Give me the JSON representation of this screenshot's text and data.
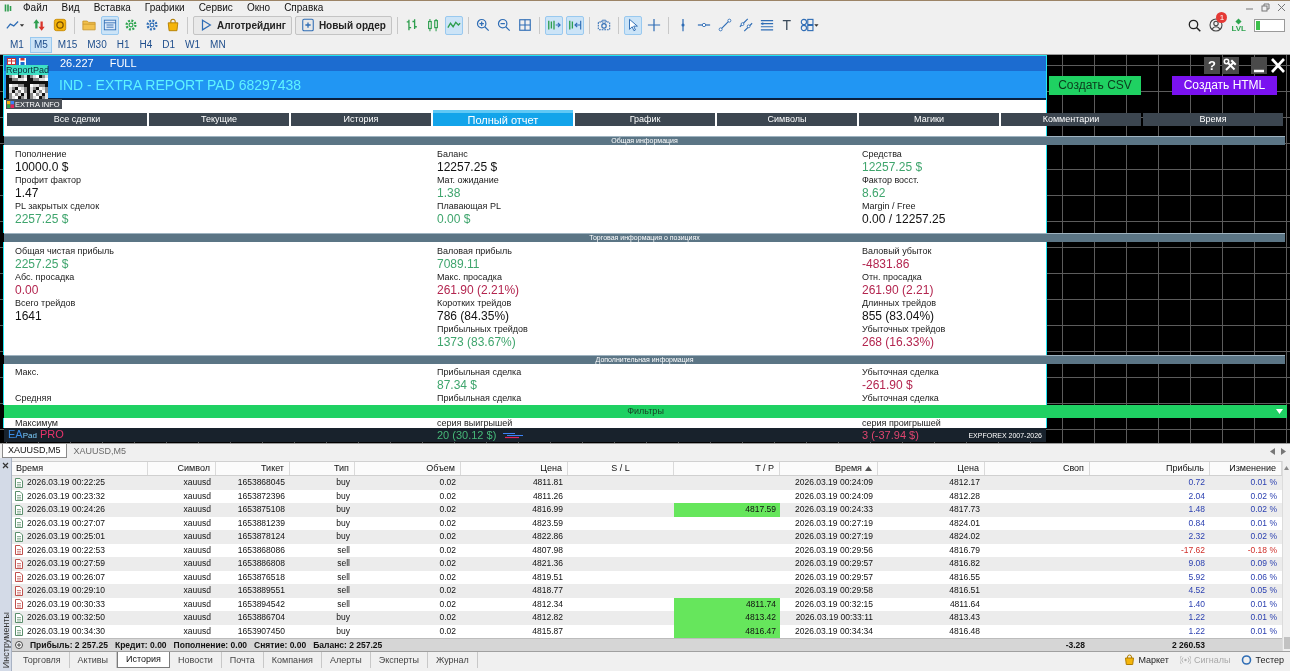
{
  "menu": [
    "Файл",
    "Вид",
    "Вставка",
    "Графики",
    "Сервис",
    "Окно",
    "Справка"
  ],
  "toolbar": {
    "items": [
      {
        "kind": "tool",
        "selected": false
      },
      {
        "kind": "tool",
        "selected": false
      },
      {
        "kind": "tool",
        "selected": false
      },
      {
        "kind": "separator"
      },
      {
        "kind": "tool",
        "selected": false
      },
      {
        "kind": "tool",
        "selected": true
      },
      {
        "kind": "tool",
        "selected": false
      },
      {
        "kind": "tool",
        "selected": false
      },
      {
        "kind": "tool",
        "selected": false
      },
      {
        "kind": "separator"
      },
      {
        "kind": "button",
        "label": "Алготрейдинг"
      },
      {
        "kind": "button",
        "label": "Новый ордер"
      },
      {
        "kind": "separator"
      },
      {
        "kind": "tool",
        "selected": false
      },
      {
        "kind": "tool",
        "selected": false
      },
      {
        "kind": "tool",
        "selected": true
      },
      {
        "kind": "separator"
      },
      {
        "kind": "tool",
        "selected": false
      },
      {
        "kind": "tool",
        "selected": false
      },
      {
        "kind": "tool",
        "selected": false
      },
      {
        "kind": "separator"
      },
      {
        "kind": "tool",
        "selected": true
      },
      {
        "kind": "tool",
        "selected": true
      },
      {
        "kind": "separator"
      },
      {
        "kind": "tool",
        "selected": false
      },
      {
        "kind": "separator"
      },
      {
        "kind": "tool",
        "selected": true
      },
      {
        "kind": "tool",
        "selected": false
      },
      {
        "kind": "separator"
      },
      {
        "kind": "tool",
        "selected": false
      },
      {
        "kind": "tool",
        "selected": false
      },
      {
        "kind": "tool",
        "selected": false
      },
      {
        "kind": "tool",
        "selected": false
      },
      {
        "kind": "tool",
        "selected": false
      },
      {
        "kind": "glyph",
        "label": "T",
        "selected": false
      },
      {
        "kind": "tool",
        "selected": false
      }
    ],
    "notifications": "1",
    "lvl_label": "LVL",
    "meter": {
      "level": 0.15
    }
  },
  "timeframes": [
    {
      "label": "M1",
      "selected": false
    },
    {
      "label": "M5",
      "selected": true
    },
    {
      "label": "M15",
      "selected": false
    },
    {
      "label": "M30",
      "selected": false
    },
    {
      "label": "H1",
      "selected": false
    },
    {
      "label": "H4",
      "selected": false
    },
    {
      "label": "D1",
      "selected": false
    },
    {
      "label": "W1",
      "selected": false
    },
    {
      "label": "MN",
      "selected": false
    }
  ],
  "report": {
    "version": "26.227",
    "mode": "FULL",
    "title": "IND - EXTRA REPORT PAD 68297438",
    "logo": {
      "label": "ReportPad",
      "caption": "EXTRA INFO"
    },
    "help_label": "?",
    "actions": [
      {
        "label": "Создать CSV",
        "color": "#1fd162"
      },
      {
        "label": "Создать HTML",
        "color": "#7a12f0"
      }
    ],
    "tabs": [
      {
        "label": "Все сделки",
        "selected": false
      },
      {
        "label": "Текущие",
        "selected": false
      },
      {
        "label": "История",
        "selected": false
      },
      {
        "label": "Полный отчет",
        "selected": true
      },
      {
        "label": "График",
        "selected": false
      },
      {
        "label": "Символы",
        "selected": false
      },
      {
        "label": "Магики",
        "selected": false
      },
      {
        "label": "Комментарии",
        "selected": false
      },
      {
        "label": "Время",
        "selected": false
      }
    ],
    "sections": [
      {
        "title": "Общая информация",
        "columns": [
          [
            {
              "label": "Пополнение",
              "value": "10000.0 $",
              "color": "#111111"
            },
            {
              "label": "Профит фактор",
              "value": "1.47",
              "color": "#111111"
            },
            {
              "label": "PL закрытых сделок",
              "value": "2257.25 $",
              "color": "#3fa56d"
            }
          ],
          [
            {
              "label": "Баланс",
              "value": "12257.25 $",
              "color": "#111111"
            },
            {
              "label": "Мат. ожидание",
              "value": "1.38",
              "color": "#3fa56d"
            },
            {
              "label": "Плавающая PL",
              "value": "0.00 $",
              "color": "#3fa56d"
            }
          ],
          [
            {
              "label": "Средства",
              "value": "12257.25 $",
              "color": "#3fa56d"
            },
            {
              "label": "Фактор восст.",
              "value": "8.62",
              "color": "#3fa56d"
            },
            {
              "label": "Margin / Free",
              "value": "0.00 / 12257.25",
              "color": "#111111"
            }
          ]
        ]
      },
      {
        "title": "Торговая информация о позициях",
        "columns": [
          [
            {
              "label": "Общая чистая прибыль",
              "value": "2257.25 $",
              "color": "#3fa56d"
            },
            {
              "label": "Абс. просадка",
              "value": "0.00",
              "color": "#b3254f"
            },
            {
              "label": "Всего трейдов",
              "value": "1641",
              "color": "#111111"
            }
          ],
          [
            {
              "label": "Валовая прибыль",
              "value": "7089.11",
              "color": "#3fa56d"
            },
            {
              "label": "Макс. просадка",
              "value": "261.90 (2.21%)",
              "color": "#b3254f"
            },
            {
              "label": "Коротких трейдов",
              "value": "786 (84.35%)",
              "color": "#111111"
            },
            {
              "label": "Прибыльных трейдов",
              "value": "1373 (83.67%)",
              "color": "#3fa56d"
            }
          ],
          [
            {
              "label": "Валовый убыток",
              "value": "-4831.86",
              "color": "#b3254f"
            },
            {
              "label": "Отн. просадка",
              "value": "261.90 (2.21)",
              "color": "#b3254f"
            },
            {
              "label": "Длинных трейдов",
              "value": "855 (83.04%)",
              "color": "#111111"
            },
            {
              "label": "Убыточных трейдов",
              "value": "268 (16.33%)",
              "color": "#b3254f"
            }
          ]
        ]
      },
      {
        "title": "Дополнительная информация",
        "columns": [
          [
            {
              "label": "Макс."
            },
            {
              "label": "Средняя"
            }
          ],
          [
            {
              "label": "Прибыльная сделка",
              "value": "87.34 $",
              "color": "#3fa56d"
            },
            {
              "label": "Прибыльная сделка"
            }
          ],
          [
            {
              "label": "Убыточная сделка",
              "value": "-261.90 $",
              "color": "#b3254f"
            },
            {
              "label": "Убыточная сделка"
            }
          ]
        ]
      }
    ],
    "filters": {
      "label": "Фильтры"
    },
    "partial_row": [
      {
        "label": "Максимум"
      },
      {
        "label": "серия выигрышей",
        "value": "20 (30.12 $)",
        "negative": false
      },
      {
        "label": "серия проигрышей",
        "value": "3 (-37.94 $)",
        "negative": true
      }
    ],
    "footer": {
      "brand": [
        "EA",
        "Pad",
        "PRO"
      ],
      "copyright": "EXPFOREX 2007-2026"
    }
  },
  "chart_tabs": [
    {
      "label": "XAUUSD,M5",
      "selected": true
    },
    {
      "label": "XAUUSD,M5",
      "selected": false
    }
  ],
  "terminal": {
    "side_label": "Инструменты",
    "columns": [
      {
        "label": "Время",
        "sorted": false
      },
      {
        "label": "Символ",
        "sorted": false
      },
      {
        "label": "Тикет",
        "sorted": false
      },
      {
        "label": "Тип",
        "sorted": false
      },
      {
        "label": "Объем",
        "sorted": false
      },
      {
        "label": "Цена",
        "sorted": false
      },
      {
        "label": "S / L",
        "sorted": false
      },
      {
        "label": "T / P",
        "sorted": false
      },
      {
        "label": "Время",
        "sorted": true
      },
      {
        "label": "Цена",
        "sorted": false
      },
      {
        "label": "Своп",
        "sorted": false
      },
      {
        "label": "Прибыль",
        "sorted": false
      },
      {
        "label": "Изменение",
        "sorted": false
      }
    ],
    "rows": [
      {
        "kind": "buy",
        "loss": false,
        "open_time": "2026.03.19 00:22:25",
        "symbol": "xauusd",
        "ticket": "1653868045",
        "type": "buy",
        "volume": "0.02",
        "open_price": "4811.81",
        "close_time": "2026.03.19 00:24:09",
        "close_price": "4812.17",
        "profit": "0.72",
        "change": "0.01 %"
      },
      {
        "kind": "buy",
        "loss": false,
        "open_time": "2026.03.19 00:23:32",
        "symbol": "xauusd",
        "ticket": "1653872396",
        "type": "buy",
        "volume": "0.02",
        "open_price": "4811.26",
        "close_time": "2026.03.19 00:24:09",
        "close_price": "4812.28",
        "profit": "2.04",
        "change": "0.02 %"
      },
      {
        "kind": "buy",
        "loss": false,
        "open_time": "2026.03.19 00:24:26",
        "symbol": "xauusd",
        "ticket": "1653875108",
        "type": "buy",
        "volume": "0.02",
        "open_price": "4816.99",
        "tp": "4817.59",
        "close_time": "2026.03.19 00:24:33",
        "close_price": "4817.73",
        "profit": "1.48",
        "change": "0.02 %"
      },
      {
        "kind": "buy",
        "loss": false,
        "open_time": "2026.03.19 00:27:07",
        "symbol": "xauusd",
        "ticket": "1653881239",
        "type": "buy",
        "volume": "0.02",
        "open_price": "4823.59",
        "close_time": "2026.03.19 00:27:19",
        "close_price": "4824.01",
        "profit": "0.84",
        "change": "0.01 %"
      },
      {
        "kind": "buy",
        "loss": false,
        "open_time": "2026.03.19 00:25:01",
        "symbol": "xauusd",
        "ticket": "1653878124",
        "type": "buy",
        "volume": "0.02",
        "open_price": "4822.86",
        "close_time": "2026.03.19 00:27:19",
        "close_price": "4824.02",
        "profit": "2.32",
        "change": "0.02 %"
      },
      {
        "kind": "sell",
        "loss": true,
        "open_time": "2026.03.19 00:22:53",
        "symbol": "xauusd",
        "ticket": "1653868086",
        "type": "sell",
        "volume": "0.02",
        "open_price": "4807.98",
        "close_time": "2026.03.19 00:29:56",
        "close_price": "4816.79",
        "profit": "-17.62",
        "change": "-0.18 %"
      },
      {
        "kind": "sell",
        "loss": false,
        "open_time": "2026.03.19 00:27:59",
        "symbol": "xauusd",
        "ticket": "1653886808",
        "type": "sell",
        "volume": "0.02",
        "open_price": "4821.36",
        "close_time": "2026.03.19 00:29:57",
        "close_price": "4816.82",
        "profit": "9.08",
        "change": "0.09 %"
      },
      {
        "kind": "sell",
        "loss": false,
        "open_time": "2026.03.19 00:26:07",
        "symbol": "xauusd",
        "ticket": "1653876518",
        "type": "sell",
        "volume": "0.02",
        "open_price": "4819.51",
        "close_time": "2026.03.19 00:29:57",
        "close_price": "4816.55",
        "profit": "5.92",
        "change": "0.06 %"
      },
      {
        "kind": "sell",
        "loss": false,
        "open_time": "2026.03.19 00:29:10",
        "symbol": "xauusd",
        "ticket": "1653889551",
        "type": "sell",
        "volume": "0.02",
        "open_price": "4818.77",
        "close_time": "2026.03.19 00:29:58",
        "close_price": "4816.51",
        "profit": "4.52",
        "change": "0.05 %"
      },
      {
        "kind": "sell",
        "loss": false,
        "open_time": "2026.03.19 00:30:33",
        "symbol": "xauusd",
        "ticket": "1653894542",
        "type": "sell",
        "volume": "0.02",
        "open_price": "4812.34",
        "tp": "4811.74",
        "close_time": "2026.03.19 00:32:15",
        "close_price": "4811.64",
        "profit": "1.40",
        "change": "0.01 %"
      },
      {
        "kind": "buy",
        "loss": false,
        "open_time": "2026.03.19 00:32:50",
        "symbol": "xauusd",
        "ticket": "1653886704",
        "type": "buy",
        "volume": "0.02",
        "open_price": "4812.82",
        "tp": "4813.42",
        "close_time": "2026.03.19 00:33:11",
        "close_price": "4813.43",
        "profit": "1.22",
        "change": "0.01 %"
      },
      {
        "kind": "buy",
        "loss": false,
        "open_time": "2026.03.19 00:34:30",
        "symbol": "xauusd",
        "ticket": "1653907450",
        "type": "buy",
        "volume": "0.02",
        "open_price": "4815.87",
        "tp": "4816.47",
        "close_time": "2026.03.19 00:34:34",
        "close_price": "4816.48",
        "profit": "1.22",
        "change": "0.01 %"
      }
    ],
    "summary": {
      "items": [
        "Прибыль: 2 257.25",
        "Кредит: 0.00",
        "Пополнение: 0.00",
        "Снятие: 0.00",
        "Баланс: 2 257.25"
      ],
      "swap": "-3.28",
      "profit": "2 260.53"
    },
    "tabs": [
      {
        "label": "Торговля",
        "selected": false
      },
      {
        "label": "Активы",
        "selected": false
      },
      {
        "label": "История",
        "selected": true
      },
      {
        "label": "Новости",
        "selected": false
      },
      {
        "label": "Почта",
        "selected": false
      },
      {
        "label": "Компания",
        "selected": false
      },
      {
        "label": "Алерты",
        "selected": false
      },
      {
        "label": "Эксперты",
        "selected": false
      },
      {
        "label": "Журнал",
        "selected": false
      }
    ],
    "status_links": [
      {
        "label": "Маркет",
        "disabled": false
      },
      {
        "label": "Сигналы",
        "disabled": true
      },
      {
        "label": "Тестер",
        "disabled": false
      }
    ]
  }
}
